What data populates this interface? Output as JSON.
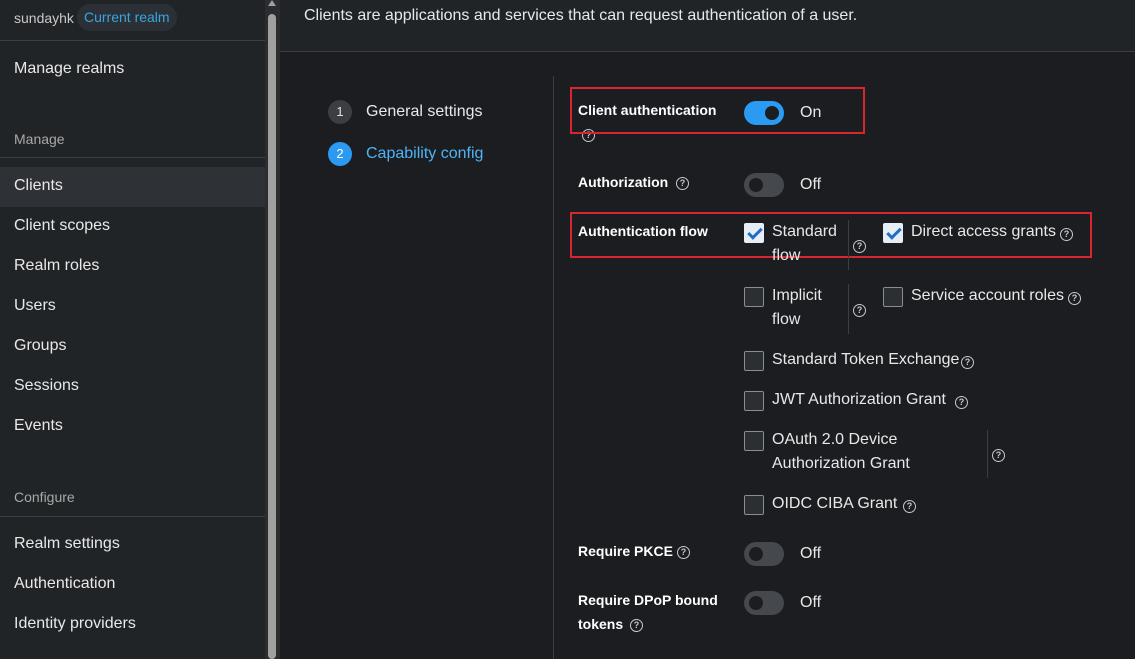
{
  "sidebar": {
    "realm_name": "sundayhk",
    "realm_badge": "Current realm",
    "manage_realms": "Manage realms",
    "manage_section": "Manage",
    "manage_items": [
      "Clients",
      "Client scopes",
      "Realm roles",
      "Users",
      "Groups",
      "Sessions",
      "Events"
    ],
    "configure_section": "Configure",
    "configure_items": [
      "Realm settings",
      "Authentication",
      "Identity providers"
    ],
    "active_item": "Clients"
  },
  "header": {
    "description": "Clients are applications and services that can request authentication of a user."
  },
  "wizard": {
    "steps": [
      {
        "number": "1",
        "label": "General settings"
      },
      {
        "number": "2",
        "label": "Capability config"
      }
    ]
  },
  "form": {
    "client_auth": {
      "label": "Client authentication",
      "state": "On",
      "enabled": true
    },
    "authorization": {
      "label": "Authorization",
      "state": "Off",
      "enabled": false
    },
    "auth_flow": {
      "label": "Authentication flow",
      "standard_flow": {
        "line1": "Standard",
        "line2": "flow",
        "checked": true
      },
      "direct_access": {
        "label": "Direct access grants",
        "checked": true
      },
      "implicit_flow": {
        "line1": "Implicit",
        "line2": "flow",
        "checked": false
      },
      "service_account": {
        "label": "Service account roles",
        "checked": false
      },
      "standard_token_exchange": {
        "label": "Standard Token Exchange",
        "checked": false
      },
      "jwt_grant": {
        "label": "JWT Authorization Grant",
        "checked": false
      },
      "oauth_device": {
        "line1": "OAuth 2.0 Device",
        "line2": "Authorization Grant",
        "checked": false
      },
      "oidc_ciba": {
        "label": "OIDC CIBA Grant",
        "checked": false
      }
    },
    "pkce": {
      "label": "Require PKCE",
      "state": "Off",
      "enabled": false
    },
    "dpop": {
      "line1": "Require DPoP bound",
      "line2": "tokens",
      "state": "Off",
      "enabled": false
    }
  },
  "icons": {
    "help": "question-circle-icon"
  },
  "colors": {
    "accent": "#2b9af3",
    "highlight": "#d9252f"
  }
}
